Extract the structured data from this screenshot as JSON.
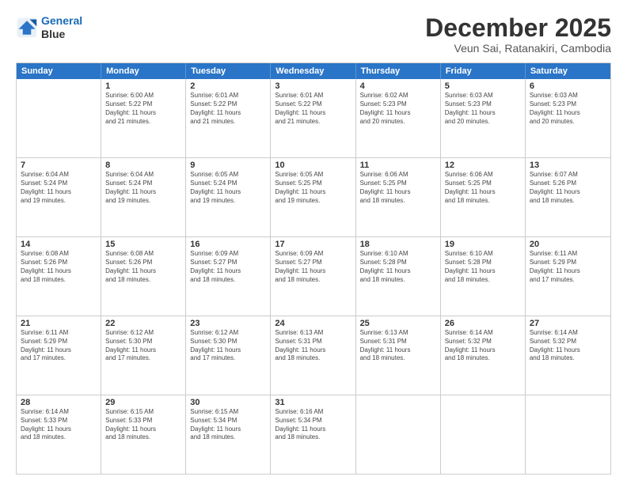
{
  "header": {
    "logo_line1": "General",
    "logo_line2": "Blue",
    "month": "December 2025",
    "location": "Veun Sai, Ratanakiri, Cambodia"
  },
  "days_of_week": [
    "Sunday",
    "Monday",
    "Tuesday",
    "Wednesday",
    "Thursday",
    "Friday",
    "Saturday"
  ],
  "weeks": [
    [
      {
        "day": "",
        "info": ""
      },
      {
        "day": "1",
        "info": "Sunrise: 6:00 AM\nSunset: 5:22 PM\nDaylight: 11 hours\nand 21 minutes."
      },
      {
        "day": "2",
        "info": "Sunrise: 6:01 AM\nSunset: 5:22 PM\nDaylight: 11 hours\nand 21 minutes."
      },
      {
        "day": "3",
        "info": "Sunrise: 6:01 AM\nSunset: 5:22 PM\nDaylight: 11 hours\nand 21 minutes."
      },
      {
        "day": "4",
        "info": "Sunrise: 6:02 AM\nSunset: 5:23 PM\nDaylight: 11 hours\nand 20 minutes."
      },
      {
        "day": "5",
        "info": "Sunrise: 6:03 AM\nSunset: 5:23 PM\nDaylight: 11 hours\nand 20 minutes."
      },
      {
        "day": "6",
        "info": "Sunrise: 6:03 AM\nSunset: 5:23 PM\nDaylight: 11 hours\nand 20 minutes."
      }
    ],
    [
      {
        "day": "7",
        "info": "Sunrise: 6:04 AM\nSunset: 5:24 PM\nDaylight: 11 hours\nand 19 minutes."
      },
      {
        "day": "8",
        "info": "Sunrise: 6:04 AM\nSunset: 5:24 PM\nDaylight: 11 hours\nand 19 minutes."
      },
      {
        "day": "9",
        "info": "Sunrise: 6:05 AM\nSunset: 5:24 PM\nDaylight: 11 hours\nand 19 minutes."
      },
      {
        "day": "10",
        "info": "Sunrise: 6:05 AM\nSunset: 5:25 PM\nDaylight: 11 hours\nand 19 minutes."
      },
      {
        "day": "11",
        "info": "Sunrise: 6:06 AM\nSunset: 5:25 PM\nDaylight: 11 hours\nand 18 minutes."
      },
      {
        "day": "12",
        "info": "Sunrise: 6:06 AM\nSunset: 5:25 PM\nDaylight: 11 hours\nand 18 minutes."
      },
      {
        "day": "13",
        "info": "Sunrise: 6:07 AM\nSunset: 5:26 PM\nDaylight: 11 hours\nand 18 minutes."
      }
    ],
    [
      {
        "day": "14",
        "info": "Sunrise: 6:08 AM\nSunset: 5:26 PM\nDaylight: 11 hours\nand 18 minutes."
      },
      {
        "day": "15",
        "info": "Sunrise: 6:08 AM\nSunset: 5:26 PM\nDaylight: 11 hours\nand 18 minutes."
      },
      {
        "day": "16",
        "info": "Sunrise: 6:09 AM\nSunset: 5:27 PM\nDaylight: 11 hours\nand 18 minutes."
      },
      {
        "day": "17",
        "info": "Sunrise: 6:09 AM\nSunset: 5:27 PM\nDaylight: 11 hours\nand 18 minutes."
      },
      {
        "day": "18",
        "info": "Sunrise: 6:10 AM\nSunset: 5:28 PM\nDaylight: 11 hours\nand 18 minutes."
      },
      {
        "day": "19",
        "info": "Sunrise: 6:10 AM\nSunset: 5:28 PM\nDaylight: 11 hours\nand 18 minutes."
      },
      {
        "day": "20",
        "info": "Sunrise: 6:11 AM\nSunset: 5:29 PM\nDaylight: 11 hours\nand 17 minutes."
      }
    ],
    [
      {
        "day": "21",
        "info": "Sunrise: 6:11 AM\nSunset: 5:29 PM\nDaylight: 11 hours\nand 17 minutes."
      },
      {
        "day": "22",
        "info": "Sunrise: 6:12 AM\nSunset: 5:30 PM\nDaylight: 11 hours\nand 17 minutes."
      },
      {
        "day": "23",
        "info": "Sunrise: 6:12 AM\nSunset: 5:30 PM\nDaylight: 11 hours\nand 17 minutes."
      },
      {
        "day": "24",
        "info": "Sunrise: 6:13 AM\nSunset: 5:31 PM\nDaylight: 11 hours\nand 18 minutes."
      },
      {
        "day": "25",
        "info": "Sunrise: 6:13 AM\nSunset: 5:31 PM\nDaylight: 11 hours\nand 18 minutes."
      },
      {
        "day": "26",
        "info": "Sunrise: 6:14 AM\nSunset: 5:32 PM\nDaylight: 11 hours\nand 18 minutes."
      },
      {
        "day": "27",
        "info": "Sunrise: 6:14 AM\nSunset: 5:32 PM\nDaylight: 11 hours\nand 18 minutes."
      }
    ],
    [
      {
        "day": "28",
        "info": "Sunrise: 6:14 AM\nSunset: 5:33 PM\nDaylight: 11 hours\nand 18 minutes."
      },
      {
        "day": "29",
        "info": "Sunrise: 6:15 AM\nSunset: 5:33 PM\nDaylight: 11 hours\nand 18 minutes."
      },
      {
        "day": "30",
        "info": "Sunrise: 6:15 AM\nSunset: 5:34 PM\nDaylight: 11 hours\nand 18 minutes."
      },
      {
        "day": "31",
        "info": "Sunrise: 6:16 AM\nSunset: 5:34 PM\nDaylight: 11 hours\nand 18 minutes."
      },
      {
        "day": "",
        "info": ""
      },
      {
        "day": "",
        "info": ""
      },
      {
        "day": "",
        "info": ""
      }
    ]
  ]
}
